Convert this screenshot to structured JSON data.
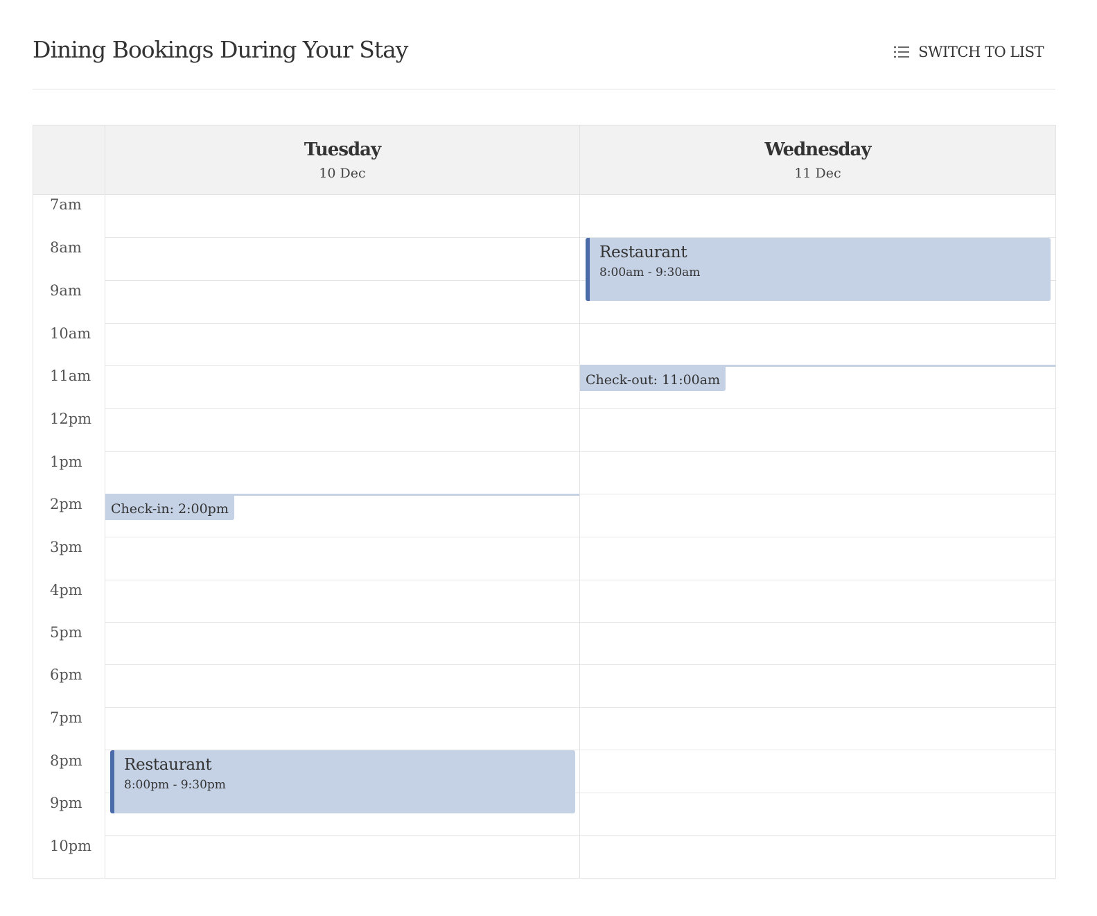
{
  "header": {
    "title": "Dining Bookings During Your Stay",
    "switch_label": "SWITCH TO LIST",
    "switch_icon": "list-icon"
  },
  "calendar": {
    "days": [
      {
        "name": "Tuesday",
        "date": "10 Dec"
      },
      {
        "name": "Wednesday",
        "date": "11 Dec"
      }
    ],
    "hours": [
      "7am",
      "8am",
      "9am",
      "10am",
      "11am",
      "12pm",
      "1pm",
      "2pm",
      "3pm",
      "4pm",
      "5pm",
      "6pm",
      "7pm",
      "8pm",
      "9pm",
      "10pm"
    ],
    "events": {
      "tue_restaurant": {
        "title": "Restaurant",
        "time": "8:00pm - 9:30pm"
      },
      "wed_restaurant": {
        "title": "Restaurant",
        "time": "8:00am - 9:30am"
      }
    },
    "markers": {
      "checkin": "Check-in: 2:00pm",
      "checkout": "Check-out: 11:00am"
    },
    "colors": {
      "event_bg": "#c5d2e5",
      "event_accent": "#4a6aa8",
      "header_bg": "#f2f2f2"
    }
  }
}
